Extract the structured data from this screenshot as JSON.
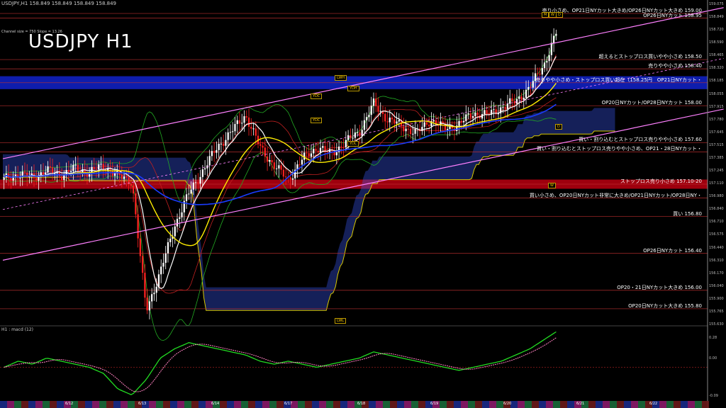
{
  "header": {
    "info": "USDJPY,H1  158.849 158.849 158.849 158.849",
    "channel": "Channel size = 750 Slope = 13.26",
    "title": "USDJPY H1",
    "macd_label": "H1 : macd (12)"
  },
  "annotations": [
    {
      "text": "売り小さめ、OP21日NYカット大きめ/OP26日NYカット大きめ 159.00",
      "price": 159.0
    },
    {
      "text": "OP26日NYカット 158.95",
      "price": 158.95
    },
    {
      "text": "超えるとストップロス買いやや小さめ 158.50",
      "price": 158.5
    },
    {
      "text": "売りやや小さめ 158.40",
      "price": 158.4
    },
    {
      "text": "売りやや小さめ・ストップロス買い超在（158.25円　OP21日NYカット・",
      "price": 158.25
    },
    {
      "text": "OP20日NYカット/OP28日NYカット 158.00",
      "price": 158.0
    },
    {
      "text": "買い・割り込むとストップロス売りやや小さめ 157.60",
      "price": 157.6
    },
    {
      "text": "買い・割り込むとストップロス売りやや小さめ、OP21・28日NYカット・",
      "price": 157.5
    },
    {
      "text": "ストップロス売り小さめ 157.10-20",
      "price": 157.15
    },
    {
      "text": "買い小さめ、OP20日NYカット非常に大きめ/OP21日NYカット/OP28日NY・",
      "price": 157.0
    },
    {
      "text": "買い 156.80",
      "price": 156.8
    },
    {
      "text": "OP26日NYカット 156.40",
      "price": 156.4
    },
    {
      "text": "OP20・21日NYカット大きめ 156.00",
      "price": 156.0
    },
    {
      "text": "OP20日NYカット大きめ 155.80",
      "price": 155.8
    }
  ],
  "level_tags": [
    "LWH",
    "YDH",
    "YDC",
    "YDC",
    "YDL",
    "LWL",
    "D",
    "W",
    "D",
    "M",
    "W"
  ],
  "price_labels": [
    "159.075",
    "158.849",
    "158.720",
    "158.590",
    "158.465",
    "158.320",
    "158.185",
    "158.055",
    "157.915",
    "157.780",
    "157.645",
    "157.515",
    "157.385",
    "157.245",
    "157.110",
    "156.980",
    "156.840",
    "156.710",
    "156.575",
    "156.440",
    "156.310",
    "156.170",
    "156.040",
    "155.900",
    "155.765",
    "155.630"
  ],
  "macd_labels": [
    "0.28",
    "0.00",
    "-0.09"
  ],
  "date_labels": [
    "6/12",
    "6/13",
    "6/14",
    "6/17",
    "6/18",
    "6/19",
    "6/20",
    "6/21",
    "6/22"
  ],
  "colors": {
    "background": "#000000",
    "bull": "#ffffff",
    "bear": "#ff2020",
    "channel": "#ff80ff",
    "ma_fast": "#ffffff",
    "ma_mid": "#ffee00",
    "ma_slow": "#1a3cff",
    "cloud": "#3b5bff",
    "resistance_band": "#1020c0",
    "support_band": "#b00010",
    "macd": "#22dd22",
    "signal": "#ff80c0"
  },
  "chart_data": {
    "type": "candlestick",
    "symbol": "USDJPY",
    "timeframe": "H1",
    "ylim": [
      155.63,
      159.1
    ],
    "last_price": 158.849,
    "dates": [
      "6/12",
      "6/13",
      "6/14",
      "6/17",
      "6/18",
      "6/19",
      "6/20",
      "6/21",
      "6/22"
    ],
    "close_path": [
      157.2,
      157.26,
      157.22,
      157.3,
      157.25,
      157.32,
      157.28,
      157.35,
      157.24,
      157.18,
      155.78,
      156.2,
      156.7,
      157.05,
      157.3,
      157.55,
      157.72,
      157.9,
      157.55,
      157.35,
      157.2,
      157.42,
      157.55,
      157.48,
      157.6,
      157.72,
      158.02,
      157.85,
      157.78,
      157.7,
      157.85,
      157.75,
      157.8,
      157.92,
      157.9,
      157.98,
      158.05,
      158.2,
      158.45,
      158.85
    ],
    "macd_path": [
      0.0,
      0.02,
      0.01,
      0.03,
      0.02,
      0.01,
      0.0,
      -0.02,
      -0.07,
      -0.09,
      -0.04,
      0.03,
      0.06,
      0.08,
      0.07,
      0.06,
      0.05,
      0.04,
      0.02,
      0.01,
      0.02,
      0.01,
      0.0,
      0.01,
      0.02,
      0.03,
      0.05,
      0.04,
      0.03,
      0.02,
      0.01,
      0.0,
      -0.01,
      0.0,
      0.01,
      0.02,
      0.04,
      0.06,
      0.09,
      0.12
    ],
    "channel": {
      "slope": 13.26,
      "size": 750
    }
  }
}
